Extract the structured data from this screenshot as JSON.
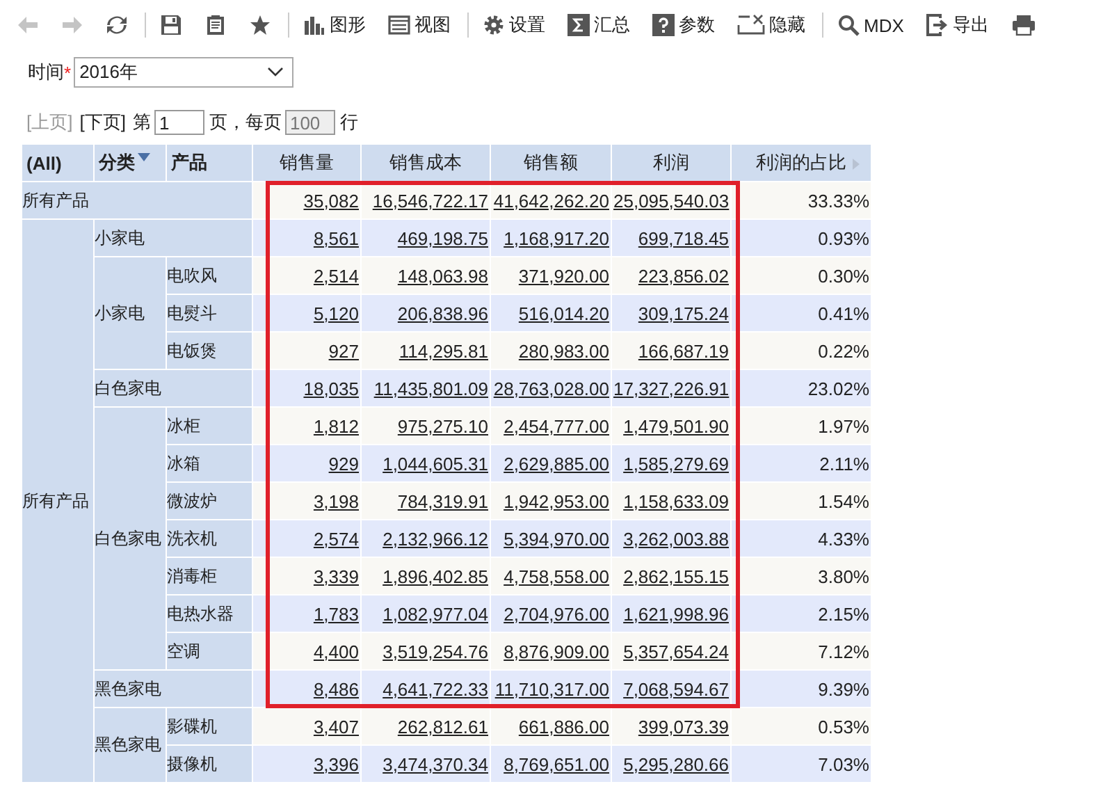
{
  "toolbar": [
    {
      "kind": "back",
      "disabled": true
    },
    {
      "kind": "forward",
      "disabled": true
    },
    {
      "kind": "refresh",
      "disabled": false
    },
    {
      "kind": "separator"
    },
    {
      "kind": "save",
      "disabled": false
    },
    {
      "kind": "paste",
      "disabled": false
    },
    {
      "kind": "star",
      "disabled": false
    },
    {
      "kind": "separator"
    },
    {
      "kind": "chart",
      "label": "图形",
      "disabled": false
    },
    {
      "kind": "view",
      "label": "视图",
      "disabled": false
    },
    {
      "kind": "separator"
    },
    {
      "kind": "settings",
      "label": "设置",
      "disabled": false
    },
    {
      "kind": "sum",
      "label": "汇总",
      "disabled": false
    },
    {
      "kind": "help",
      "label": "参数",
      "disabled": false
    },
    {
      "kind": "hide",
      "label": "隐藏",
      "disabled": false
    },
    {
      "kind": "separator"
    },
    {
      "kind": "search",
      "label": "MDX",
      "disabled": false
    },
    {
      "kind": "export",
      "label": "导出",
      "disabled": false
    },
    {
      "kind": "print",
      "disabled": false
    }
  ],
  "filter": {
    "label": "时间",
    "required_mark": "*",
    "value": "2016年"
  },
  "pager": {
    "prev": {
      "label": "[上页]",
      "disabled": true
    },
    "next": {
      "label": "[下页]",
      "disabled": false
    },
    "page_prefix": "第",
    "page": "1",
    "page_suffix": "页，每页",
    "page_size": "100",
    "rows_suffix": "行"
  },
  "table": {
    "columns": [
      {
        "label": "(All)",
        "kind": "dim"
      },
      {
        "label": "分类",
        "kind": "dim",
        "sorted": true
      },
      {
        "label": "产品",
        "kind": "dim"
      },
      {
        "label": "销售量",
        "kind": "measure"
      },
      {
        "label": "销售成本",
        "kind": "measure"
      },
      {
        "label": "销售额",
        "kind": "measure"
      },
      {
        "label": "利润",
        "kind": "measure"
      },
      {
        "label": "利润的占比",
        "kind": "measure",
        "expandable": true
      }
    ],
    "rows": [
      {
        "label": "所有产品",
        "values": [
          "35,082",
          "16,546,722.17",
          "41,642,262.20",
          "25,095,540.03"
        ],
        "share": "33.33%",
        "highlighted": true,
        "group_label": "所有产品",
        "children": [
          {
            "label": "小家电",
            "values": [
              "8,561",
              "469,198.75",
              "1,168,917.20",
              "699,718.45"
            ],
            "share": "0.93%",
            "highlighted": true,
            "group_label": "小家电",
            "children": [
              {
                "label": "电吹风",
                "values": [
                  "2,514",
                  "148,063.98",
                  "371,920.00",
                  "223,856.02"
                ],
                "share": "0.30%",
                "highlighted": true
              },
              {
                "label": "电熨斗",
                "values": [
                  "5,120",
                  "206,838.96",
                  "516,014.20",
                  "309,175.24"
                ],
                "share": "0.41%",
                "highlighted": true
              },
              {
                "label": "电饭煲",
                "values": [
                  "927",
                  "114,295.81",
                  "280,983.00",
                  "166,687.19"
                ],
                "share": "0.22%",
                "highlighted": true
              }
            ]
          },
          {
            "label": "白色家电",
            "values": [
              "18,035",
              "11,435,801.09",
              "28,763,028.00",
              "17,327,226.91"
            ],
            "share": "23.02%",
            "highlighted": true,
            "group_label": "白色家电",
            "children": [
              {
                "label": "冰柜",
                "values": [
                  "1,812",
                  "975,275.10",
                  "2,454,777.00",
                  "1,479,501.90"
                ],
                "share": "1.97%",
                "highlighted": true
              },
              {
                "label": "冰箱",
                "values": [
                  "929",
                  "1,044,605.31",
                  "2,629,885.00",
                  "1,585,279.69"
                ],
                "share": "2.11%",
                "highlighted": true
              },
              {
                "label": "微波炉",
                "values": [
                  "3,198",
                  "784,319.91",
                  "1,942,953.00",
                  "1,158,633.09"
                ],
                "share": "1.54%",
                "highlighted": true
              },
              {
                "label": "洗衣机",
                "values": [
                  "2,574",
                  "2,132,966.12",
                  "5,394,970.00",
                  "3,262,003.88"
                ],
                "share": "4.33%",
                "highlighted": true
              },
              {
                "label": "消毒柜",
                "values": [
                  "3,339",
                  "1,896,402.85",
                  "4,758,558.00",
                  "2,862,155.15"
                ],
                "share": "3.80%",
                "highlighted": true
              },
              {
                "label": "电热水器",
                "values": [
                  "1,783",
                  "1,082,977.04",
                  "2,704,976.00",
                  "1,621,998.96"
                ],
                "share": "2.15%",
                "highlighted": true
              },
              {
                "label": "空调",
                "values": [
                  "4,400",
                  "3,519,254.76",
                  "8,876,909.00",
                  "5,357,654.24"
                ],
                "share": "7.12%",
                "highlighted": true
              }
            ]
          },
          {
            "label": "黑色家电",
            "values": [
              "8,486",
              "4,641,722.33",
              "11,710,317.00",
              "7,068,594.67"
            ],
            "share": "9.39%",
            "highlighted": true,
            "group_label": "黑色家电",
            "children": [
              {
                "label": "影碟机",
                "values": [
                  "3,407",
                  "262,812.61",
                  "661,886.00",
                  "399,073.39"
                ],
                "share": "0.53%",
                "highlighted": false
              },
              {
                "label": "摄像机",
                "values": [
                  "3,396",
                  "3,474,370.34",
                  "8,769,651.00",
                  "5,295,280.66"
                ],
                "share": "7.03%",
                "highlighted": false
              }
            ]
          }
        ]
      }
    ]
  }
}
